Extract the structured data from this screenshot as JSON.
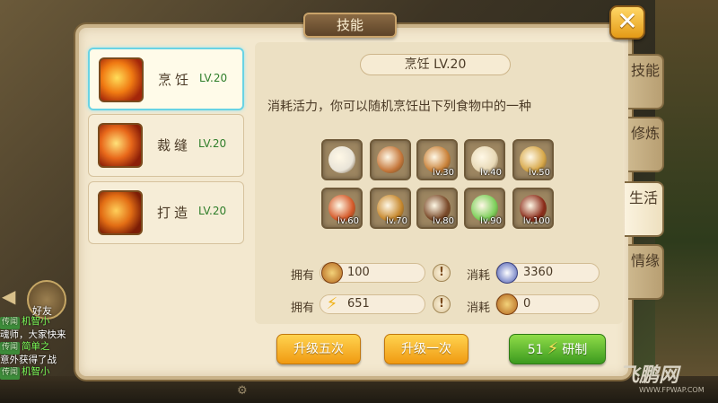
{
  "window": {
    "title": "技能",
    "close_label": "✕"
  },
  "skills": [
    {
      "name": "烹饪",
      "level": "LV.20",
      "icon": "cooking-icon",
      "active": true
    },
    {
      "name": "裁缝",
      "level": "LV.20",
      "icon": "tailoring-icon",
      "active": false
    },
    {
      "name": "打造",
      "level": "LV.20",
      "icon": "forging-icon",
      "active": false
    }
  ],
  "detail": {
    "heading": "烹饪 LV.20",
    "description": "消耗活力，你可以随机烹饪出下列食物中的一种",
    "foods": [
      {
        "icon": "tofu-dish-icon",
        "level": ""
      },
      {
        "icon": "fish-dish-icon",
        "level": ""
      },
      {
        "icon": "roast-chicken-icon",
        "level": "lv.30"
      },
      {
        "icon": "spring-roll-icon",
        "level": "lv.40"
      },
      {
        "icon": "wine-cup-icon",
        "level": "lv.50"
      },
      {
        "icon": "shrimp-skewer-icon",
        "level": "lv.60"
      },
      {
        "icon": "soup-bowl-icon",
        "level": "lv.70"
      },
      {
        "icon": "meat-slices-icon",
        "level": "lv.80"
      },
      {
        "icon": "vegetable-dish-icon",
        "level": "lv.90"
      },
      {
        "icon": "plum-dish-icon",
        "level": "lv.100"
      }
    ],
    "stats": {
      "own_label": "拥有",
      "cost_label": "消耗",
      "own_1_value": "100",
      "cost_1_value": "3360",
      "own_2_value": "651",
      "cost_2_value": "0",
      "warn_glyph": "!"
    },
    "buttons": {
      "upgrade_five": "升级五次",
      "upgrade_once": "升级一次",
      "research_count": "51",
      "research_label": "研制"
    }
  },
  "tabs": [
    {
      "label": "技能",
      "active": false
    },
    {
      "label": "修炼",
      "active": false
    },
    {
      "label": "生活",
      "active": true
    },
    {
      "label": "情缘",
      "active": false
    }
  ],
  "hud": {
    "friend_label": "好友",
    "chat": [
      {
        "tag": "传闻",
        "name": "机智小",
        "text": ""
      },
      {
        "tag": "",
        "name": "",
        "text": "魂师，大家快来"
      },
      {
        "tag": "传闻",
        "name": "简单之",
        "text": ""
      },
      {
        "tag": "",
        "name": "",
        "text": "意外获得了战"
      },
      {
        "tag": "传闻",
        "name": "机智小",
        "text": ""
      }
    ]
  },
  "watermark": {
    "main": "飞鹏网",
    "sub": "WWW.FPWAP.COM"
  },
  "colors": {
    "accent_green": "#2f7e2a",
    "active_border": "#69d3e4",
    "close_orange": "#e49a16"
  }
}
